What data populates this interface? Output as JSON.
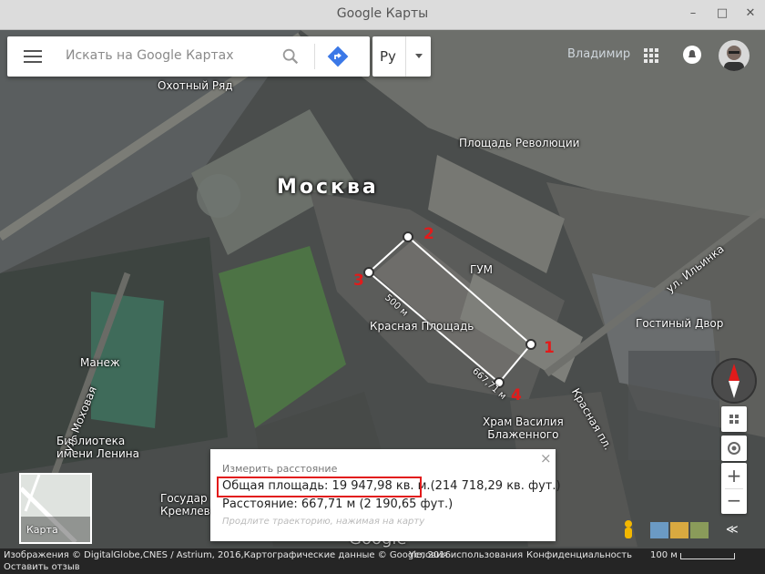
{
  "window": {
    "title": "Google Карты",
    "controls": {
      "minimize": "–",
      "maximize": "□",
      "close": "✕"
    }
  },
  "search": {
    "placeholder": "Искать на Google Картах",
    "language": "Ру"
  },
  "account": {
    "name": "Владимир"
  },
  "map": {
    "city_label": "Москва",
    "labels": {
      "okhotny_ryad": "Охотный Ряд",
      "ploshchad_revolyutsii": "Площадь Революции",
      "gum": "ГУМ",
      "krasnaya_ploshchad": "Красная Площадь",
      "gostiny_dvor": "Гостиный Двор",
      "manezh": "Манеж",
      "khram_line1": "Храм Василия",
      "khram_line2": "Блаженного",
      "biblioteka_line1": "Библиотека",
      "biblioteka_line2": "имени Ленина",
      "gosudar_line1": "Государ",
      "gosudar_line2": "Кремлевский"
    },
    "streets": {
      "ilyinka": "ул. Ильинка",
      "mokhovaya": "ул. Моховая",
      "krasnaya_pl": "Красная пл."
    },
    "segment_labels": {
      "side_a": "500 м",
      "side_b": "667,71 м"
    },
    "points": [
      "1",
      "2",
      "3",
      "4"
    ],
    "watermark": "Google"
  },
  "measure": {
    "header": "Измерить расстояние",
    "close": "×",
    "area": "Общая площадь: 19 947,98 кв. м.",
    "area_ft": "(214 718,29 кв. фут.)",
    "distance": "Расстояние: 667,71 м (2 190,65 фут.)",
    "hint": "Продлите траекторию, нажимая на карту"
  },
  "minimap": {
    "label": "Карта"
  },
  "controls": {
    "zoom_in": "+",
    "zoom_out": "−",
    "expand": "≪"
  },
  "footer": {
    "credits": "Изображения © DigitalGlobe,CNES / Astrium, 2016,Картографические данные © Google, 2016",
    "terms": "Условия использования",
    "privacy": "Конфиденциальность",
    "scale": "100 м",
    "feedback": "Оставить отзыв"
  }
}
